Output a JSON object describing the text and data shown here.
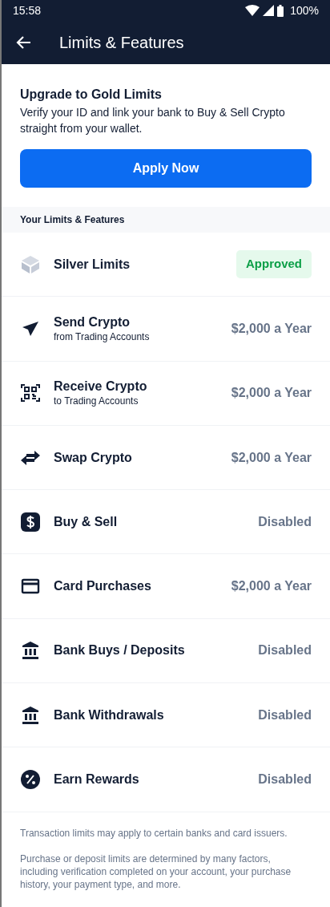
{
  "status_bar": {
    "time": "15:58",
    "battery": "100%"
  },
  "header": {
    "title": "Limits & Features"
  },
  "upgrade": {
    "title": "Upgrade to Gold Limits",
    "text": "Verify your ID and link your bank to Buy & Sell Crypto straight from your wallet.",
    "button": "Apply Now"
  },
  "section_title": "Your Limits & Features",
  "features": [
    {
      "name": "Silver Limits",
      "value": "Approved",
      "kind": "badge"
    },
    {
      "name": "Send Crypto",
      "subtitle": "from Trading Accounts",
      "value": "$2,000 a Year",
      "kind": "text"
    },
    {
      "name": "Receive Crypto",
      "subtitle": "to Trading Accounts",
      "value": "$2,000 a Year",
      "kind": "text"
    },
    {
      "name": "Swap Crypto",
      "value": "$2,000 a Year",
      "kind": "text"
    },
    {
      "name": "Buy & Sell",
      "value": "Disabled",
      "kind": "text"
    },
    {
      "name": "Card Purchases",
      "value": "$2,000 a Year",
      "kind": "text"
    },
    {
      "name": "Bank Buys / Deposits",
      "value": "Disabled",
      "kind": "text"
    },
    {
      "name": "Bank Withdrawals",
      "value": "Disabled",
      "kind": "text"
    },
    {
      "name": "Earn Rewards",
      "value": "Disabled",
      "kind": "text"
    }
  ],
  "footnotes": [
    "Transaction limits may apply to certain banks and card issuers.",
    "Purchase or deposit limits are determined by many factors, including verification completed on your account, your purchase history, your payment type, and more."
  ]
}
